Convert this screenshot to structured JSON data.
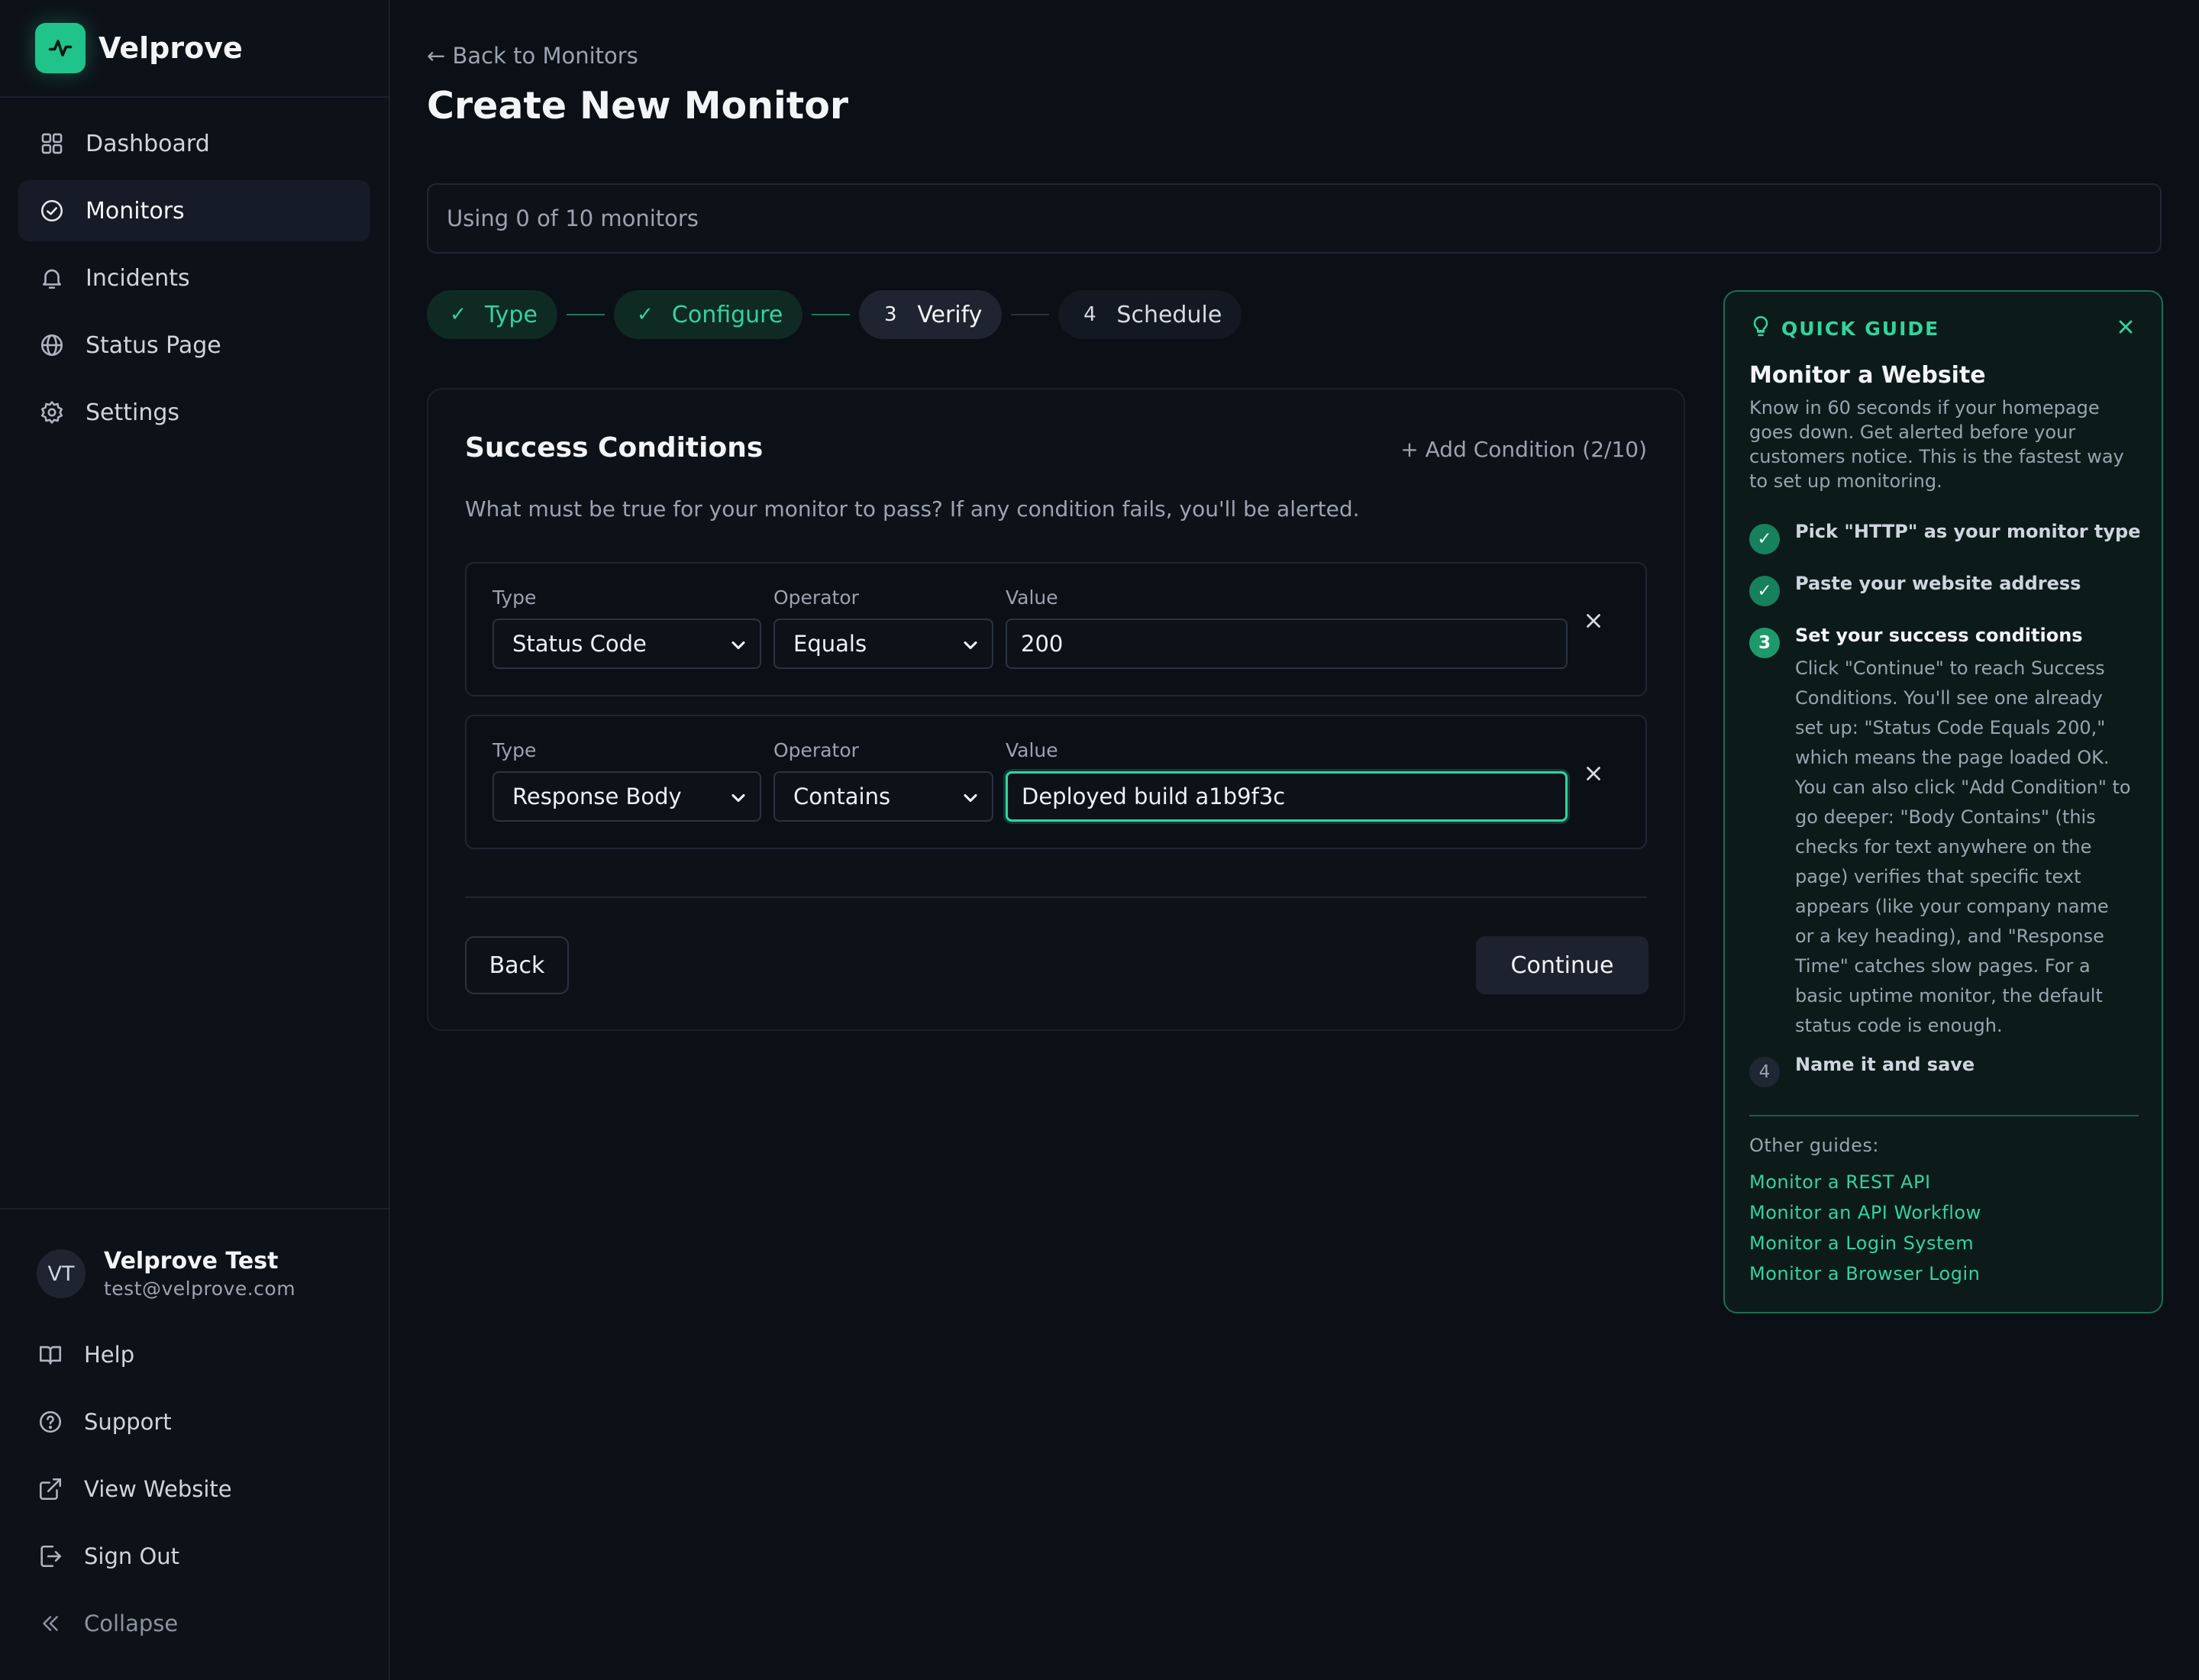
{
  "brand": {
    "name": "Velprove",
    "logo_icon": "activity-icon",
    "accent": "#20c38a"
  },
  "nav": {
    "items": [
      {
        "label": "Dashboard",
        "icon": "grid-icon",
        "active": false
      },
      {
        "label": "Monitors",
        "icon": "check-circle-icon",
        "active": true
      },
      {
        "label": "Incidents",
        "icon": "bell-icon",
        "active": false
      },
      {
        "label": "Status Page",
        "icon": "globe-icon",
        "active": false
      },
      {
        "label": "Settings",
        "icon": "gear-icon",
        "active": false
      }
    ]
  },
  "user": {
    "initials": "VT",
    "name": "Velprove Test",
    "email": "test@velprove.com"
  },
  "bottom_nav": [
    {
      "label": "Help",
      "icon": "book-icon"
    },
    {
      "label": "Support",
      "icon": "help-circle-icon"
    },
    {
      "label": "View Website",
      "icon": "external-link-icon"
    },
    {
      "label": "Sign Out",
      "icon": "sign-out-icon"
    },
    {
      "label": "Collapse",
      "icon": "chevrons-left-icon"
    }
  ],
  "header": {
    "back_link": "← Back to Monitors",
    "title": "Create New Monitor"
  },
  "usage": {
    "text": "Using 0 of 10 monitors"
  },
  "stepper": {
    "steps": [
      {
        "label": "Type",
        "mark": "✓",
        "state": "done"
      },
      {
        "label": "Configure",
        "mark": "✓",
        "state": "done"
      },
      {
        "label": "Verify",
        "mark": "3",
        "state": "current"
      },
      {
        "label": "Schedule",
        "mark": "4",
        "state": "pending"
      }
    ]
  },
  "card": {
    "title": "Success Conditions",
    "add_condition": "+ Add Condition (2/10)",
    "description": "What must be true for your monitor to pass? If any condition fails, you'll be alerted.",
    "labels": {
      "type": "Type",
      "operator": "Operator",
      "value": "Value"
    },
    "conditions": [
      {
        "type": "Status Code",
        "operator": "Equals",
        "value": "200",
        "focused": false
      },
      {
        "type": "Response Body",
        "operator": "Contains",
        "value": "Deployed build a1b9f3c",
        "focused": true
      }
    ],
    "back_label": "Back",
    "continue_label": "Continue"
  },
  "guide": {
    "header": "QUICK GUIDE",
    "title": "Monitor a Website",
    "description": "Know in 60 seconds if your homepage goes down. Get alerted before your customers notice. This is the fastest way to set up monitoring.",
    "steps": [
      {
        "badge": "✓",
        "state": "done",
        "title": "Pick \"HTTP\" as your monitor type"
      },
      {
        "badge": "✓",
        "state": "done",
        "title": "Paste your website address"
      },
      {
        "badge": "3",
        "state": "current",
        "title": "Set your success conditions",
        "body": "Click \"Continue\" to reach Success Conditions. You'll see one already set up: \"Status Code Equals 200,\" which means the page loaded OK. You can also click \"Add Condition\" to go deeper: \"Body Contains\" (this checks for text anywhere on the page) verifies that specific text appears (like your company name or a key heading), and \"Response Time\" catches slow pages. For a basic uptime monitor, the default status code is enough."
      },
      {
        "badge": "4",
        "state": "todo",
        "title": "Name it and save"
      }
    ],
    "other_label": "Other guides:",
    "other_links": [
      "Monitor a REST API",
      "Monitor an API Workflow",
      "Monitor a Login System",
      "Monitor a Browser Login"
    ]
  }
}
